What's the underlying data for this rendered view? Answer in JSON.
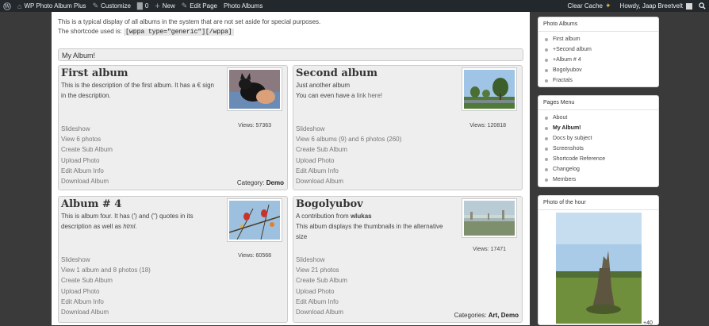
{
  "adminbar": {
    "site_name": "WP Photo Album Plus",
    "customize": "Customize",
    "comments_count": "0",
    "new": "New",
    "edit_page": "Edit Page",
    "photo_albums": "Photo Albums",
    "clear_cache": "Clear Cache",
    "howdy": "Howdy, Jaap Breetvelt"
  },
  "intro": {
    "line1": "This is a typical display of all albums in the system that are not set aside for special purposes.",
    "line2_prefix": "The shortcode used is:",
    "shortcode": "[wppa type=\"generic\"][/wppa]"
  },
  "album_header": "My Album!",
  "albums": [
    {
      "title": "First album",
      "desc1": "This is the description of the first album. It has a € sign in the description.",
      "views": "Views: 57363",
      "links": [
        "Slideshow",
        "View 6 photos",
        "Create Sub Album",
        "Upload Photo",
        "Edit Album Info",
        "Download Album"
      ],
      "category_label": "Category:",
      "category": "Demo"
    },
    {
      "title": "Second album",
      "desc1": "Just another album",
      "desc2_prefix": "You can even have a",
      "desc2_link": "link here!",
      "views": "Views: 120818",
      "links": [
        "Slideshow",
        "View 6 albums (9) and 6 photos (260)",
        "Create Sub Album",
        "Upload Photo",
        "Edit Album Info",
        "Download Album"
      ]
    },
    {
      "title": "Album # 4",
      "desc1": "This is album four. It has (') and (\") quotes in its description as well as",
      "desc1_em": "html",
      "desc1_end": ".",
      "views": "Views: 60568",
      "links": [
        "Slideshow",
        "View 1 album and 8 photos (18)",
        "Create Sub Album",
        "Upload Photo",
        "Edit Album Info",
        "Download Album"
      ]
    },
    {
      "title": "Bogolyubov",
      "desc1_prefix": "A contribution from",
      "desc1_bold": "wlukas",
      "desc2": "This album displays the thumbnails in the alternative size",
      "views": "Views: 17471",
      "links": [
        "Slideshow",
        "View 21 photos",
        "Create Sub Album",
        "Upload Photo",
        "Edit Album Info",
        "Download Album"
      ],
      "category_label": "Categories:",
      "category": "Art, Demo"
    }
  ],
  "widgets": {
    "photo_albums": {
      "title": "Photo Albums",
      "items": [
        "First album",
        "+Second album",
        "+Album # 4",
        "Bogolyubov",
        "Fractals"
      ]
    },
    "pages_menu": {
      "title": "Pages Menu",
      "items": [
        "About",
        "My Album!",
        "Docs by subject",
        "Screenshots",
        "Shortcode Reference",
        "Changelog",
        "Members"
      ]
    },
    "photo_of_hour": {
      "title": "Photo of the hour",
      "counter": "+40"
    }
  },
  "colors": {
    "adminbar_bg": "#23282d",
    "page_bg": "#3a3a3a",
    "card_bg": "#eeeeee",
    "link_gray": "#777777"
  }
}
